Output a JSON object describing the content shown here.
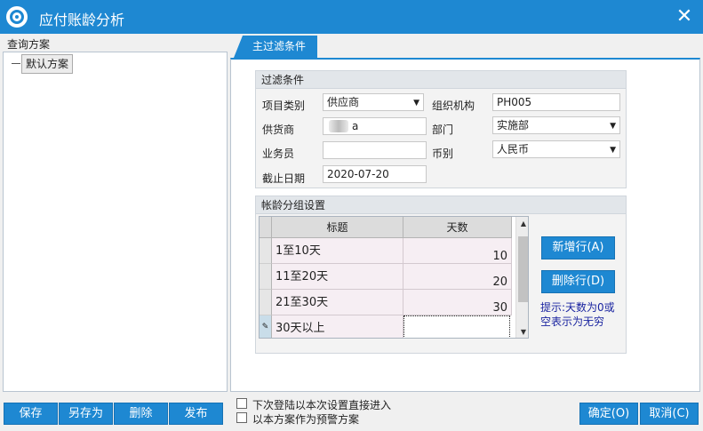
{
  "window": {
    "title": "应付账龄分析",
    "close_glyph": "✕"
  },
  "left": {
    "header": "查询方案",
    "tree": [
      {
        "label": "默认方案"
      }
    ],
    "buttons": {
      "save": "保存",
      "save_as": "另存为",
      "delete": "删除",
      "publish": "发布"
    }
  },
  "tab": {
    "label": "主过滤条件"
  },
  "filter": {
    "group_title": "过滤条件",
    "item_type_label": "项目类别",
    "item_type_value": "供应商",
    "org_label": "组织机构",
    "org_value": "PH005",
    "supplier_label": "供货商",
    "supplier_value": "a",
    "dept_label": "部门",
    "dept_value": "实施部",
    "salesman_label": "业务员",
    "salesman_value": "",
    "currency_label": "币别",
    "currency_value": "人民币",
    "cutoff_label": "截止日期",
    "cutoff_value": "2020-07-20"
  },
  "aging": {
    "group_title": "帐龄分组设置",
    "columns": {
      "title": "标题",
      "days": "天数"
    },
    "rows": [
      {
        "title": "1至10天",
        "days": "10"
      },
      {
        "title": "11至20天",
        "days": "20"
      },
      {
        "title": "21至30天",
        "days": "30"
      },
      {
        "title": "30天以上",
        "days": ""
      }
    ],
    "add_row_button": "新增行(A)",
    "delete_row_button": "删除行(D)",
    "hint": "提示:天数为0或空表示为无穷"
  },
  "bottom": {
    "checkbox_direct": "下次登陆以本次设置直接进入",
    "checkbox_warning": "以本方案作为预警方案",
    "ok_button": "确定(O)",
    "cancel_button": "取消(C)"
  },
  "colors": {
    "accent": "#1e88d2",
    "grid_row": "#f6eef3",
    "hint_text": "#1a24a0"
  }
}
